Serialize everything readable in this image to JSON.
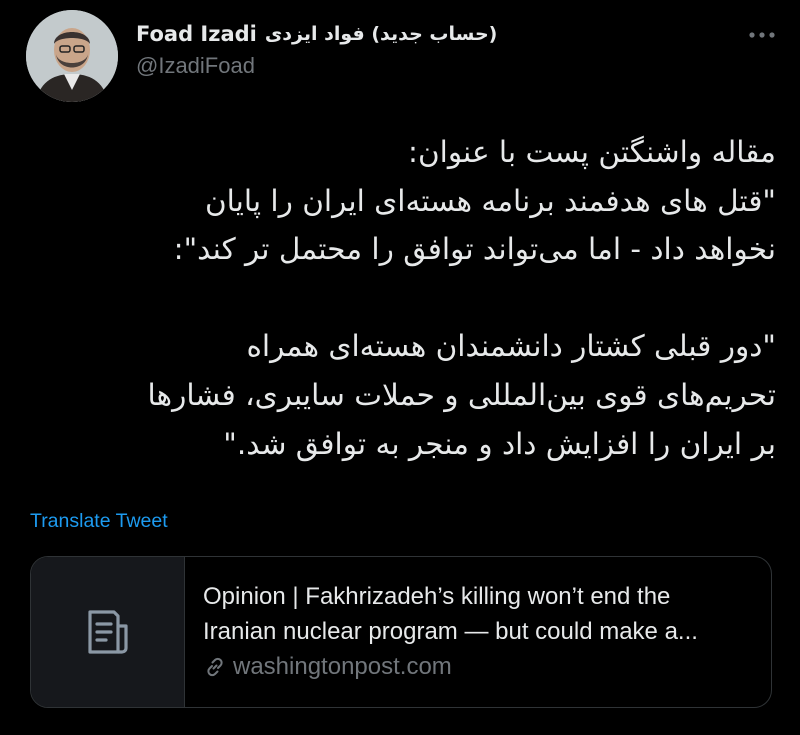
{
  "tweet": {
    "author": {
      "name": "Foad Izadi",
      "name_fa": "(حساب جدید) فواد ایزدی",
      "handle": "@IzadiFoad"
    },
    "text_lines": [
      "مقاله واشنگتن پست با عنوان:",
      "\"قتل های هدفمند برنامه هسته‌ای ایران را پایان",
      "نخواهد داد - اما می‌تواند توافق را محتمل تر کند\":",
      "",
      "\"دور قبلی کشتار دانشمندان هسته‌ای همراه",
      "تحریم‌های قوی بین‌المللی و حملات سایبری، فشارها",
      "بر ایران را افزایش داد و منجر به توافق شد.\""
    ],
    "translate_label": "Translate Tweet",
    "link_card": {
      "title_line1": "Opinion | Fakhrizadeh’s killing won’t end the",
      "title_line2": "Iranian nuclear program — but could make a...",
      "domain": "washingtonpost.com",
      "thumb_icon": "document-icon",
      "domain_icon": "link-icon"
    }
  },
  "colors": {
    "background": "#000000",
    "text": "#e7e9ea",
    "secondary": "#71767b",
    "accent": "#1d9bf0",
    "border": "#2f3336"
  }
}
